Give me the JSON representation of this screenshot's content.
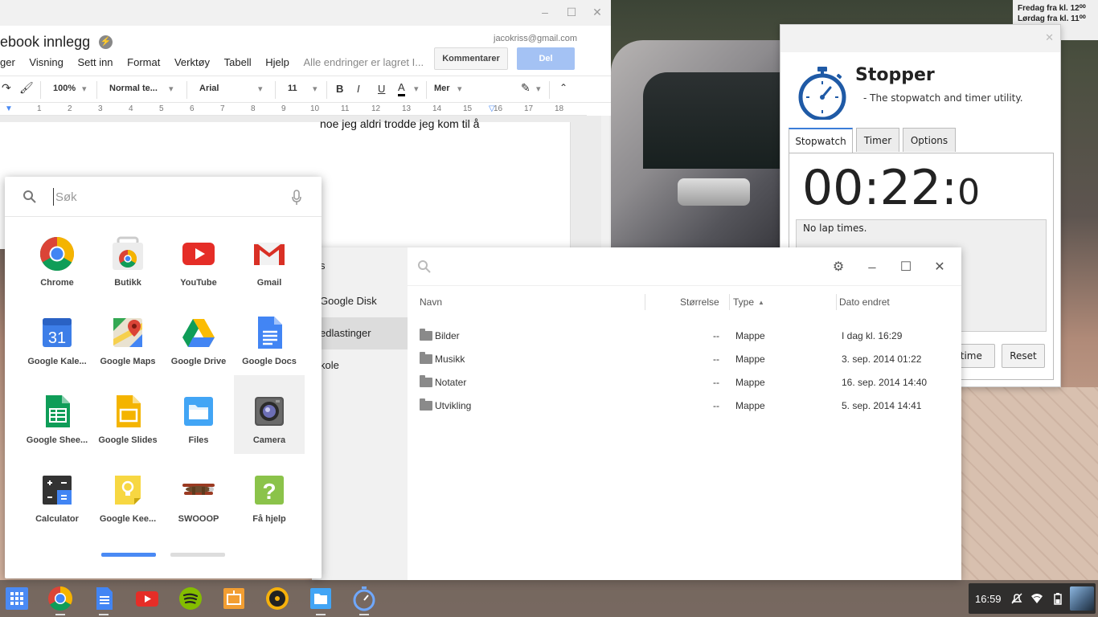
{
  "wallpaper": {
    "sign_lines": [
      "Fredag fra kl. 12⁰⁰",
      "Lørdag fra kl. 11⁰⁰"
    ]
  },
  "docs": {
    "title": "ebook innlegg",
    "account_email": "jacokriss@gmail.com",
    "menu": [
      "ger",
      "Visning",
      "Sett inn",
      "Format",
      "Verktøy",
      "Tabell",
      "Hjelp"
    ],
    "saved_status": "Alle endringer er lagret I...",
    "comment_button": "Kommentarer",
    "share_button": "Del",
    "toolbar": {
      "zoom": "100%",
      "style": "Normal te...",
      "font": "Arial",
      "size": "11",
      "bold": "B",
      "italic": "I",
      "underline": "U",
      "text_color": "A",
      "more": "Mer"
    },
    "ruler_numbers": [
      "1",
      "2",
      "3",
      "4",
      "5",
      "6",
      "7",
      "8",
      "9",
      "10",
      "11",
      "12",
      "13",
      "14",
      "15",
      "16",
      "17",
      "18"
    ],
    "body_text": "noe jeg aldri trodde jeg kom til å"
  },
  "stopwatch": {
    "title": "Stopper",
    "subtitle": "- The stopwatch and timer utility.",
    "tabs": [
      "Stopwatch",
      "Timer",
      "Options"
    ],
    "active_tab": "Stopwatch",
    "time_main": "00:22:",
    "time_fraction": "0",
    "laps_text": "No lap times.",
    "button_laptime": "ptime",
    "button_reset": "Reset"
  },
  "files": {
    "sidebar": [
      "s",
      "Google Disk",
      "edlastinger",
      "kole"
    ],
    "selected_sidebar": "edlastinger",
    "columns": {
      "name": "Navn",
      "size": "Størrelse",
      "type": "Type",
      "sort_indicator": "▲",
      "date": "Dato endret"
    },
    "rows": [
      {
        "name": "Bilder",
        "size": "--",
        "type": "Mappe",
        "date": "I dag kl. 16:29"
      },
      {
        "name": "Musikk",
        "size": "--",
        "type": "Mappe",
        "date": "3. sep. 2014 01:22"
      },
      {
        "name": "Notater",
        "size": "--",
        "type": "Mappe",
        "date": "16. sep. 2014 14:40"
      },
      {
        "name": "Utvikling",
        "size": "--",
        "type": "Mappe",
        "date": "5. sep. 2014 14:41"
      }
    ]
  },
  "launcher": {
    "search_placeholder": "Søk",
    "apps": [
      {
        "label": "Chrome",
        "icon": "chrome-icon"
      },
      {
        "label": "Butikk",
        "icon": "webstore-icon"
      },
      {
        "label": "YouTube",
        "icon": "youtube-icon"
      },
      {
        "label": "Gmail",
        "icon": "gmail-icon"
      },
      {
        "label": "Google Kale...",
        "icon": "calendar-icon"
      },
      {
        "label": "Google Maps",
        "icon": "maps-icon"
      },
      {
        "label": "Google Drive",
        "icon": "drive-icon"
      },
      {
        "label": "Google Docs",
        "icon": "docs-icon"
      },
      {
        "label": "Google Shee...",
        "icon": "sheets-icon"
      },
      {
        "label": "Google Slides",
        "icon": "slides-icon"
      },
      {
        "label": "Files",
        "icon": "files-icon"
      },
      {
        "label": "Camera",
        "icon": "camera-icon"
      },
      {
        "label": "Calculator",
        "icon": "calculator-icon"
      },
      {
        "label": "Google Kee...",
        "icon": "keep-icon"
      },
      {
        "label": "SWOOOP",
        "icon": "swooop-icon"
      },
      {
        "label": "Få hjelp",
        "icon": "help-icon"
      }
    ],
    "calendar_day": "31",
    "page_count": 2,
    "current_page": 1
  },
  "shelf": {
    "items": [
      "launcher-icon",
      "chrome-icon",
      "docs-icon",
      "youtube-icon",
      "spotify-icon",
      "slides-icon",
      "music-player-icon",
      "files-icon",
      "stopwatch-icon"
    ],
    "time": "16:59"
  },
  "colors": {
    "accent_blue": "#4a8af4",
    "share_button": "#a4c2f4",
    "tab_accent": "#3b7dd8"
  }
}
